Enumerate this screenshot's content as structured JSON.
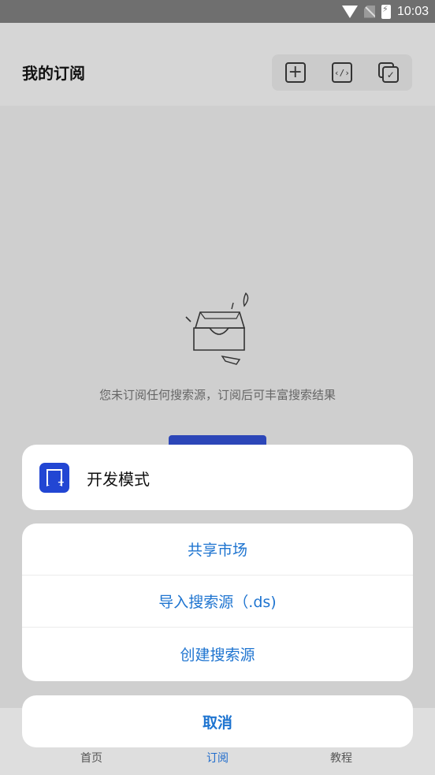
{
  "status_bar": {
    "time": "10:03",
    "icons": [
      "wifi-icon",
      "no-sim-icon",
      "battery-charging-icon"
    ]
  },
  "header": {
    "title": "我的订阅",
    "actions": [
      {
        "icon": "add-square-icon",
        "symbol": "+"
      },
      {
        "icon": "code-icon",
        "symbol": "‹/›"
      },
      {
        "icon": "multi-select-icon",
        "symbol": "✓"
      }
    ]
  },
  "empty_state": {
    "illustration": "empty-inbox-illustration",
    "message": "您未订阅任何搜索源，订阅后可丰富搜索结果"
  },
  "bottom_nav": {
    "items": [
      {
        "label": "首页",
        "active": false
      },
      {
        "label": "订阅",
        "active": true
      },
      {
        "label": "教程",
        "active": false
      }
    ]
  },
  "sheet": {
    "header": {
      "icon": "bookmark-add-icon",
      "label": "开发模式"
    },
    "options": [
      {
        "label": "共享市场"
      },
      {
        "label": "导入搜索源（.ds)"
      },
      {
        "label": "创建搜索源"
      }
    ],
    "cancel_label": "取消"
  },
  "colors": {
    "accent": "#1e74d0",
    "brand_icon": "#2246d3",
    "overlay": "#cfcfcf"
  }
}
